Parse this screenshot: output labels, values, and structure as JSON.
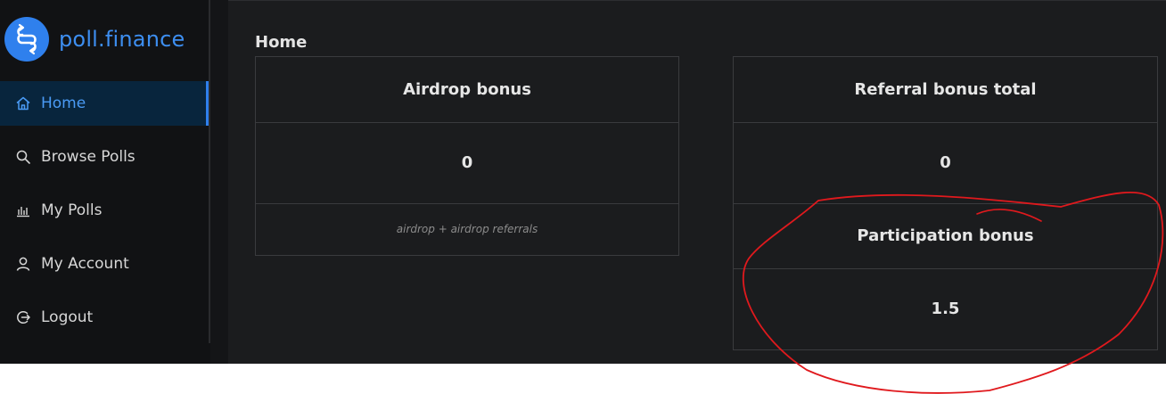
{
  "brand": {
    "name": "poll.finance"
  },
  "sidebar": {
    "items": [
      {
        "label": "Home",
        "icon": "home-icon",
        "active": true
      },
      {
        "label": "Browse Polls",
        "icon": "search-icon",
        "active": false
      },
      {
        "label": "My Polls",
        "icon": "bar-chart-icon",
        "active": false
      },
      {
        "label": "My Account",
        "icon": "user-icon",
        "active": false
      },
      {
        "label": "Logout",
        "icon": "logout-icon",
        "active": false
      }
    ]
  },
  "main": {
    "title": "Home",
    "airdrop_card": {
      "header": "Airdrop bonus",
      "value": "0",
      "footer": "airdrop + airdrop referrals"
    },
    "referral_card": {
      "header": "Referral bonus total",
      "value": "0",
      "sub_header": "Participation bonus",
      "sub_value": "1.5"
    }
  },
  "colors": {
    "accent": "#2f80ed",
    "sidebar_bg": "#111214",
    "main_bg": "#1b1c1e",
    "annotation": "#e0191d"
  }
}
